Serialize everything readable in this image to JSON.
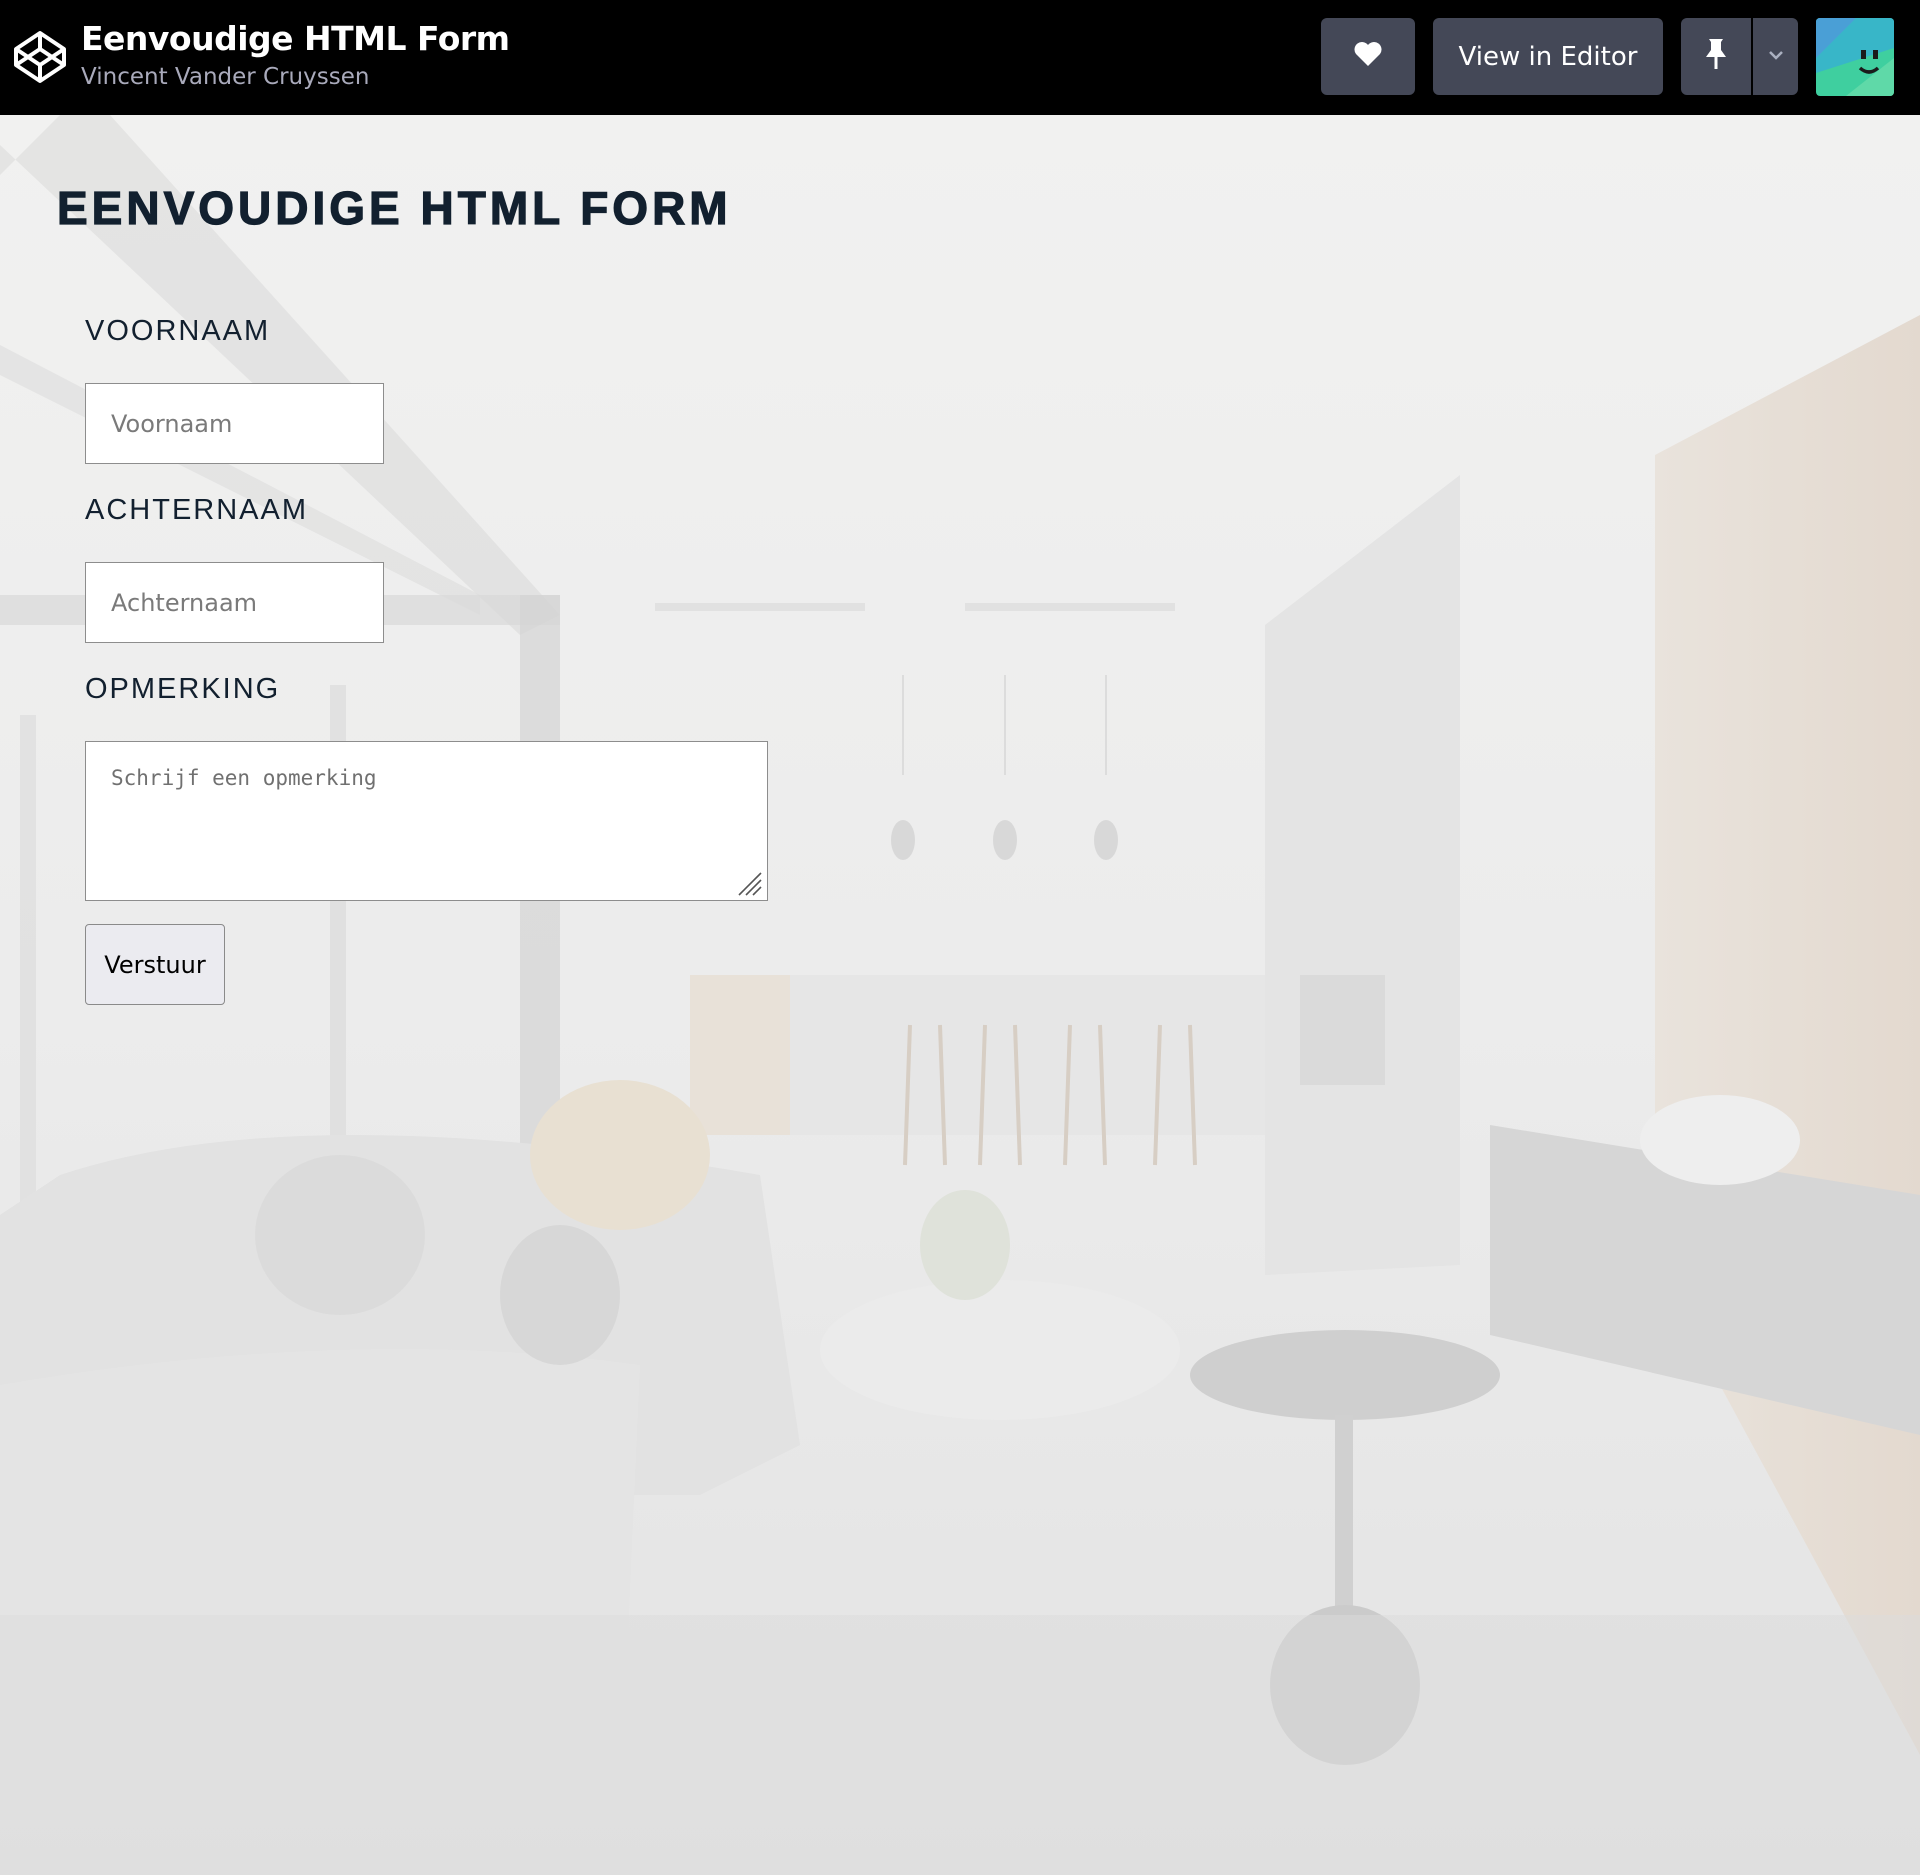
{
  "header": {
    "title": "Eenvoudige HTML Form",
    "author": "Vincent Vander Cruyssen",
    "view_in_editor_label": "View in Editor",
    "icons": {
      "logo": "codepen-logo-icon",
      "like": "heart-icon",
      "pin": "pin-icon",
      "dropdown": "chevron-down-icon",
      "avatar": "smiley-avatar-icon"
    }
  },
  "form": {
    "heading": "EENVOUDIGE HTML FORM",
    "first_name_label": "VOORNAAM",
    "first_name_placeholder": "Voornaam",
    "last_name_label": "ACHTERNAAM",
    "last_name_placeholder": "Achternaam",
    "comment_label": "OPMERKING",
    "comment_placeholder": "Schrijf een opmerking",
    "submit_label": "Verstuur"
  },
  "colors": {
    "header_bg": "#000000",
    "button_bg": "#444857",
    "heading_text": "#12202f"
  }
}
